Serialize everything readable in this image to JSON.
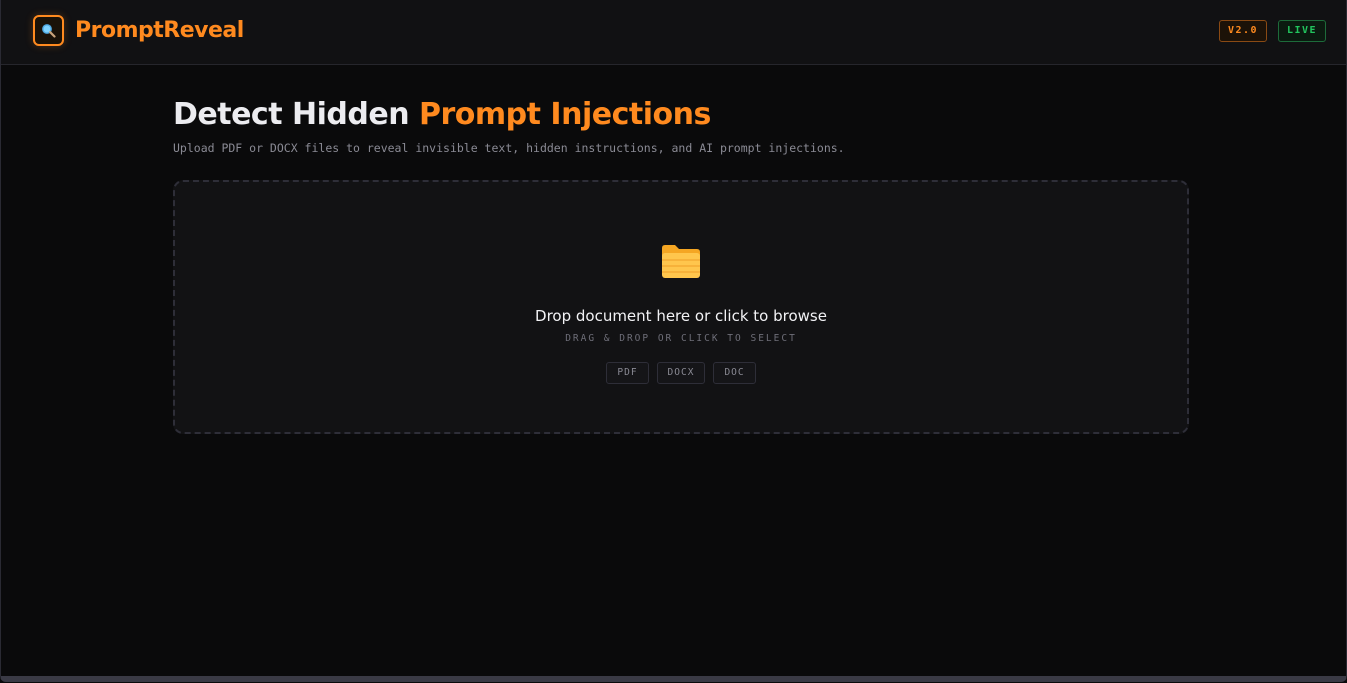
{
  "header": {
    "brand": "PromptReveal",
    "version_badge": "V2.0",
    "status_badge": "LIVE"
  },
  "hero": {
    "title_part1": "Detect Hidden",
    "title_part2": "Prompt Injections",
    "subtitle": "Upload PDF or DOCX files to reveal invisible text, hidden instructions, and AI prompt injections."
  },
  "dropzone": {
    "icon": "folder-icon",
    "title": "Drop document here or click to browse",
    "hint": "DRAG & DROP OR CLICK TO SELECT",
    "formats": [
      "PDF",
      "DOCX",
      "DOC"
    ]
  },
  "colors": {
    "accent": "#ff8a1f",
    "live": "#22c55e",
    "background": "#0a0a0b"
  }
}
